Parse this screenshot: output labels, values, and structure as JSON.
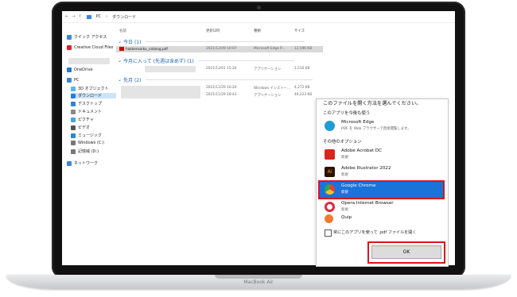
{
  "laptop": {
    "brand": "MacBook Air"
  },
  "explorer": {
    "breadcrumb": [
      "PC",
      "ダウンロード"
    ],
    "sidebar": {
      "quick_access": "クイック アクセス",
      "creative_cloud": "Creative Cloud Files",
      "onedrive": "OneDrive",
      "pc": "PC",
      "items": [
        "3D オブジェクト",
        "ダウンロード",
        "デスクトップ",
        "ドキュメント",
        "ピクチャ",
        "ビデオ",
        "ミュージック",
        "Windows (C:)",
        "記憶域 (D:)"
      ],
      "network": "ネットワーク"
    },
    "columns": {
      "name": "名前",
      "date": "更新日時",
      "type": "種類",
      "size": "サイズ"
    },
    "groups": {
      "today": "今日 (1)",
      "favorites": "今月に入って (先週は含めず) (1)",
      "last_month": "先月 (2)"
    },
    "rows": {
      "today": {
        "name": "hakkensaiko_catalog.pdf",
        "date": "2021/12/09 10:07",
        "type": "Microsoft Edge P...",
        "size": "12,596 KB"
      },
      "favorites": {
        "name": "",
        "date": "2021/12/01 15:24",
        "type": "アプリケーション",
        "size": "1,510 KB"
      },
      "last_month": [
        {
          "name": "",
          "date": "2021/11/29 16:20",
          "type": "Windows インストー...",
          "size": "4,272 KB"
        },
        {
          "name": "",
          "date": "2021/11/29 18:43",
          "type": "アプリケーション",
          "size": "49,223 KB"
        }
      ]
    }
  },
  "dialog": {
    "title": "このファイルを開く方法を選んでください。",
    "always_use": "このアプリを今後も使う",
    "other_options": "その他のオプション",
    "apps": [
      {
        "name": "Microsoft Edge",
        "desc": "PDF を Web ブラウザーで直接閲覧します。",
        "icon": "edge-icon",
        "color": "#1f9bd7"
      },
      {
        "name": "Adobe Acrobat DC",
        "desc": "新規",
        "icon": "acrobat-icon",
        "color": "#d7261c"
      },
      {
        "name": "Adobe Illustrator 2022",
        "desc": "新規",
        "icon": "illustrator-icon",
        "color": "#2b1200"
      },
      {
        "name": "Google Chrome",
        "desc": "新規",
        "icon": "chrome-icon",
        "color": "#e34133"
      },
      {
        "name": "Opera Internet Browser",
        "desc": "新規",
        "icon": "opera-icon",
        "color": "#e3263d"
      },
      {
        "name": "Quip",
        "desc": "",
        "icon": "quip-icon",
        "color": "#f27a2d"
      }
    ],
    "selected_app": "Google Chrome",
    "checkbox_label": "常にこのアプリを使って .pdf ファイルを開く",
    "ok_label": "OK",
    "highlight_color": "#e0121e",
    "accent": "#1a73d9"
  }
}
